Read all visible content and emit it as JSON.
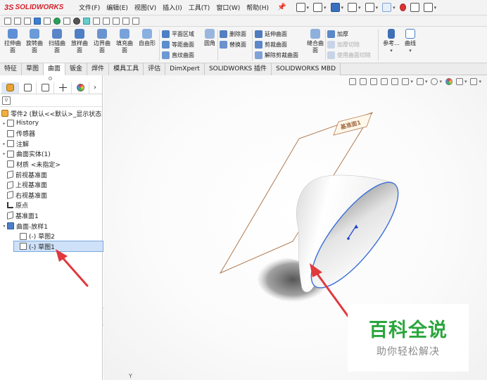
{
  "app": {
    "logo_ds": "3S",
    "logo_name": "SOLIDWORKS"
  },
  "menu": [
    "文件(F)",
    "编辑(E)",
    "视图(V)",
    "插入(I)",
    "工具(T)",
    "窗口(W)",
    "帮助(H)"
  ],
  "ribbon": {
    "big_buttons": [
      "拉伸曲面",
      "旋转曲面",
      "扫描曲面",
      "放样曲面",
      "边界曲面",
      "填充曲面",
      "自由形"
    ],
    "group1": [
      "平面区域",
      "等距曲面",
      "直纹曲面"
    ],
    "fillet": "圆角",
    "group2": [
      "删除面",
      "替换面"
    ],
    "group3": [
      "延伸曲面",
      "剪裁曲面",
      "解除剪裁曲面"
    ],
    "knit": "缝合曲面",
    "group4": [
      "加厚",
      "加厚切除",
      "使用曲面切除"
    ],
    "reference": "参考...",
    "curves": "曲线"
  },
  "tabs": [
    "特征",
    "草图",
    "曲面",
    "钣金",
    "焊件",
    "模具工具",
    "评估",
    "DimXpert",
    "SOLIDWORKS 插件",
    "SOLIDWORKS MBD"
  ],
  "active_tab": "曲面",
  "tree": {
    "root": "零件2 (默认<<默认>_显示状态",
    "items": [
      {
        "label": "History",
        "expandable": true,
        "indent": 1
      },
      {
        "label": "传感器",
        "expandable": false,
        "indent": 1
      },
      {
        "label": "注解",
        "expandable": true,
        "indent": 1
      },
      {
        "label": "曲面实体(1)",
        "expandable": true,
        "indent": 1
      },
      {
        "label": "材质 <未指定>",
        "expandable": false,
        "indent": 1
      },
      {
        "label": "前视基准面",
        "expandable": false,
        "indent": 1
      },
      {
        "label": "上视基准面",
        "expandable": false,
        "indent": 1
      },
      {
        "label": "右视基准面",
        "expandable": false,
        "indent": 1
      },
      {
        "label": "原点",
        "expandable": false,
        "indent": 1
      },
      {
        "label": "基准面1",
        "expandable": false,
        "indent": 1
      },
      {
        "label": "曲面-放样1",
        "expandable": true,
        "indent": 1
      },
      {
        "label": "(-) 草图2",
        "expandable": false,
        "indent": 2
      },
      {
        "label": "(-) 草图1",
        "expandable": false,
        "indent": 2,
        "selected": true
      }
    ]
  },
  "viewport": {
    "plane_label": "基准面1"
  },
  "watermark": {
    "title": "百科全说",
    "subtitle": "助你轻松解决"
  },
  "colors": {
    "accent_red": "#d4202b",
    "annotation_arrow": "#e0393e",
    "watermark_green": "#2aa63c",
    "selection_blue": "#cfe1f8"
  }
}
